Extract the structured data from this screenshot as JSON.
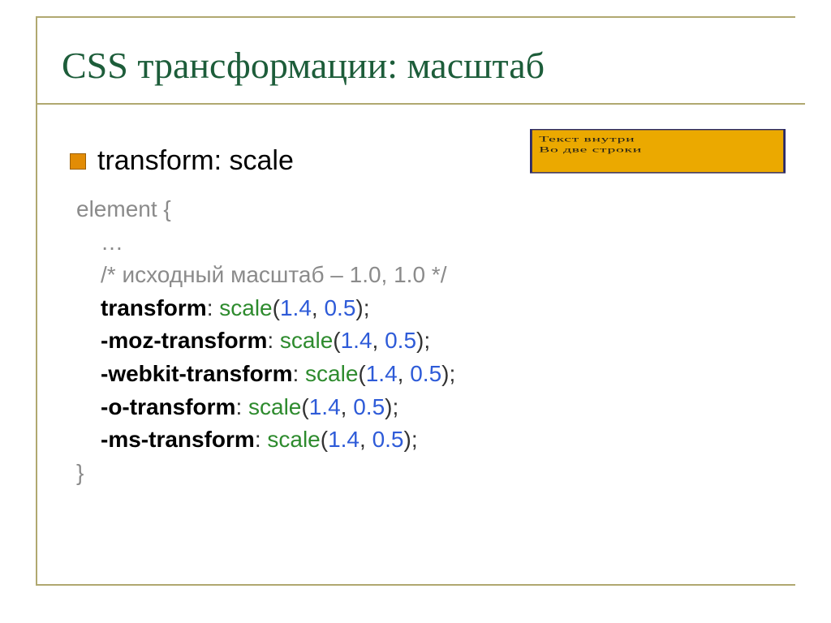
{
  "title": "CSS трансформации: масштаб",
  "bullet": "transform: scale",
  "example": {
    "line1": "Текст внутри",
    "line2": "Во две строки"
  },
  "code": {
    "selector": "element {",
    "ellipsis": "…",
    "comment": "/* исходный масштаб – 1.0, 1.0 */",
    "close": "}",
    "props": [
      {
        "name": "transform",
        "fn": "scale",
        "a": "1.4",
        "b": "0.5"
      },
      {
        "name": "-moz-transform",
        "fn": "scale",
        "a": "1.4",
        "b": "0.5"
      },
      {
        "name": "-webkit-transform",
        "fn": "scale",
        "a": "1.4",
        "b": "0.5"
      },
      {
        "name": "-o-transform",
        "fn": "scale",
        "a": "1.4",
        "b": "0.5"
      },
      {
        "name": "-ms-transform",
        "fn": "scale",
        "a": "1.4",
        "b": "0.5"
      }
    ]
  }
}
